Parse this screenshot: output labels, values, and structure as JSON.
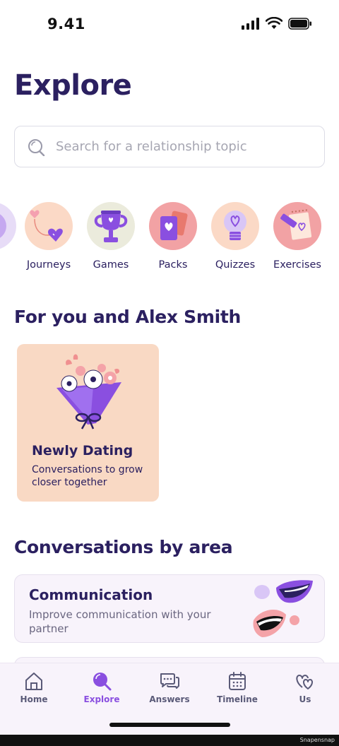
{
  "status": {
    "time": "9.41"
  },
  "header": {
    "title": "Explore"
  },
  "search": {
    "placeholder": "Search for a relationship topic"
  },
  "categories": [
    {
      "label": "ns",
      "icon": "conversations-icon"
    },
    {
      "label": "Journeys",
      "icon": "journeys-icon"
    },
    {
      "label": "Games",
      "icon": "trophy-icon"
    },
    {
      "label": "Packs",
      "icon": "cards-icon"
    },
    {
      "label": "Quizzes",
      "icon": "lightbulb-icon"
    },
    {
      "label": "Exercises",
      "icon": "notepad-icon"
    }
  ],
  "for_you": {
    "title": "For you and Alex Smith",
    "cards": [
      {
        "title": "Newly Dating",
        "subtitle": "Conversations to grow closer together",
        "icon": "bouquet-icon"
      }
    ]
  },
  "areas": {
    "title": "Conversations by area",
    "cards": [
      {
        "title": "Communication",
        "subtitle": "Improve communication with your partner",
        "icon": "lips-icon"
      }
    ]
  },
  "tabs": [
    {
      "label": "Home",
      "icon": "home-icon",
      "active": false
    },
    {
      "label": "Explore",
      "icon": "explore-icon",
      "active": true
    },
    {
      "label": "Answers",
      "icon": "chat-bubbles-icon",
      "active": false
    },
    {
      "label": "Timeline",
      "icon": "calendar-icon",
      "active": false
    },
    {
      "label": "Us",
      "icon": "hearts-icon",
      "active": false
    }
  ],
  "colors": {
    "accent": "#8a4fe0",
    "title": "#2b2060",
    "peach": "#f9d9c4",
    "card_bg": "#f8f3fb"
  },
  "watermark": "Snapensnap"
}
